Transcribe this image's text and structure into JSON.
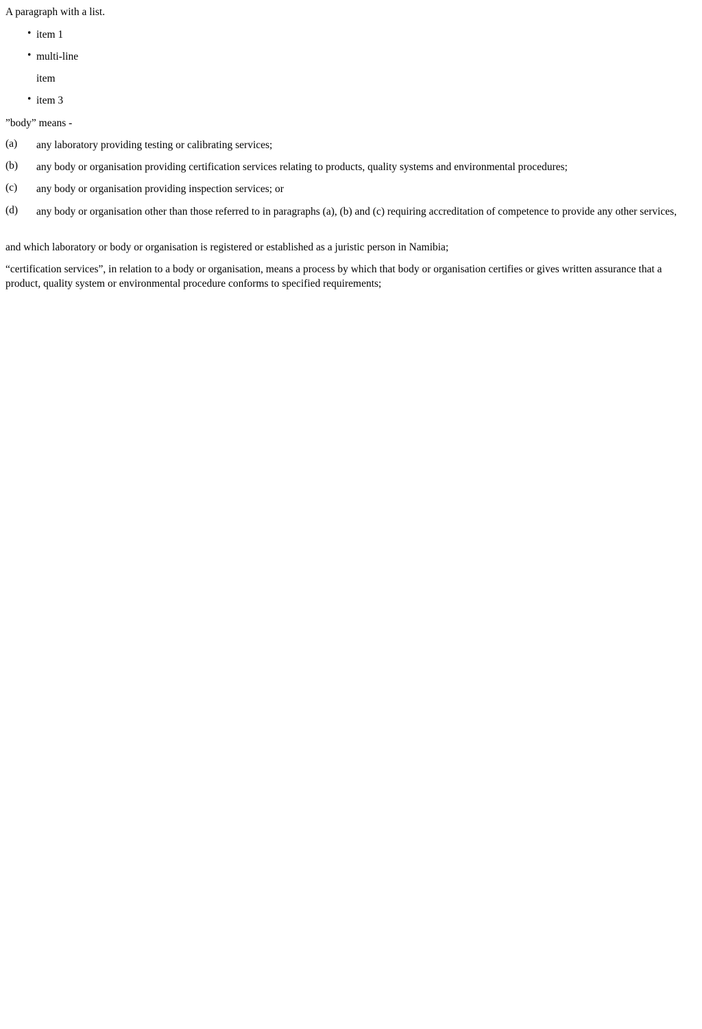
{
  "intro": "A paragraph with a list.",
  "bullets": [
    "item 1",
    "multi-line",
    "item",
    "item 3"
  ],
  "bullet_glyph": "•",
  "body_def": "”body” means -",
  "items": [
    {
      "label": "(a)",
      "text": "any laboratory providing testing or calibrating services;"
    },
    {
      "label": "(b)",
      "text": "any body or organisation providing certification services relating to products, quality systems and environmental procedures;"
    },
    {
      "label": "(c)",
      "text": "any body or organisation providing inspection services; or"
    },
    {
      "label": "(d)",
      "text": "any body or organisation other than those referred to in paragraphs (a), (b) and (c) requiring accreditation of competence to provide any other services,"
    }
  ],
  "closing": "and which laboratory or body or organisation is registered or established as a juristic person in Namibia;",
  "cert_def": "“certification services”, in relation to a body or organisation, means a process by which that body or organisation certifies or gives written assurance that a product, quality system or environmental procedure conforms to specified requirements;"
}
